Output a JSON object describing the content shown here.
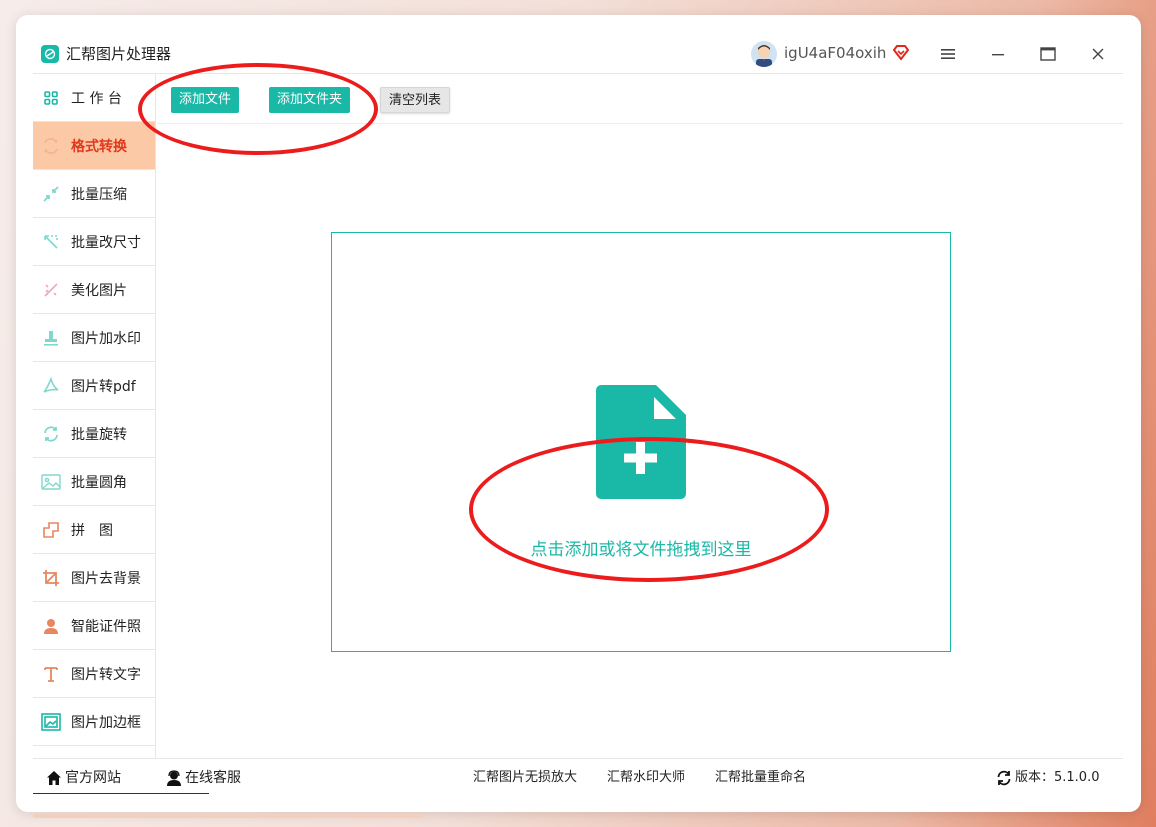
{
  "app": {
    "title": "汇帮图片处理器"
  },
  "user": {
    "name": "igU4aF04oxih"
  },
  "sidebar": {
    "items": [
      {
        "label": "工 作 台",
        "icon": "grid-icon"
      },
      {
        "label": "格式转换",
        "icon": "convert-icon"
      },
      {
        "label": "批量压缩",
        "icon": "compress-icon"
      },
      {
        "label": "批量改尺寸",
        "icon": "resize-icon"
      },
      {
        "label": "美化图片",
        "icon": "beautify-icon"
      },
      {
        "label": "图片加水印",
        "icon": "stamp-icon"
      },
      {
        "label": "图片转pdf",
        "icon": "pdf-icon"
      },
      {
        "label": "批量旋转",
        "icon": "rotate-icon"
      },
      {
        "label": "批量圆角",
        "icon": "image-icon"
      },
      {
        "label": "拼　图",
        "icon": "puzzle-icon"
      },
      {
        "label": "图片去背景",
        "icon": "crop-icon"
      },
      {
        "label": "智能证件照",
        "icon": "person-icon"
      },
      {
        "label": "图片转文字",
        "icon": "text-icon"
      },
      {
        "label": "图片加边框",
        "icon": "frame-icon"
      }
    ],
    "active_index": 1
  },
  "toolbar": {
    "add_file": "添加文件",
    "add_folder": "添加文件夹",
    "clear_list": "清空列表"
  },
  "dropzone": {
    "text": "点击添加或将文件拖拽到这里"
  },
  "footer": {
    "site": "官方网站",
    "service": "在线客服",
    "link1": "汇帮图片无损放大",
    "link2": "汇帮水印大师",
    "link3": "汇帮批量重命名",
    "version": "版本：5.1.0.0"
  },
  "colors": {
    "accent": "#1ab8a6",
    "active_bg": "#fcc9a6",
    "active_text": "#e0391d",
    "annotation": "#ec1c1c"
  }
}
